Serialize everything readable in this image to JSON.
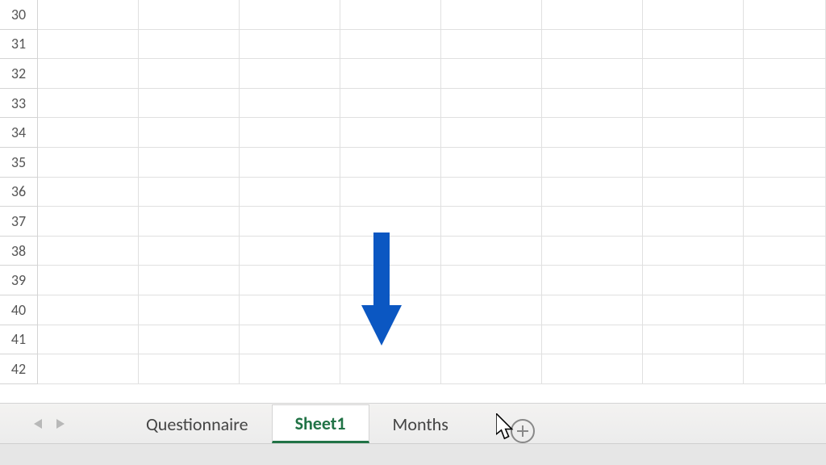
{
  "rows": [
    "30",
    "31",
    "32",
    "33",
    "34",
    "35",
    "36",
    "37",
    "38",
    "39",
    "40",
    "41",
    "42"
  ],
  "tabs": [
    {
      "label": "Questionnaire",
      "active": false
    },
    {
      "label": "Sheet1",
      "active": true
    },
    {
      "label": "Months",
      "active": false
    }
  ]
}
